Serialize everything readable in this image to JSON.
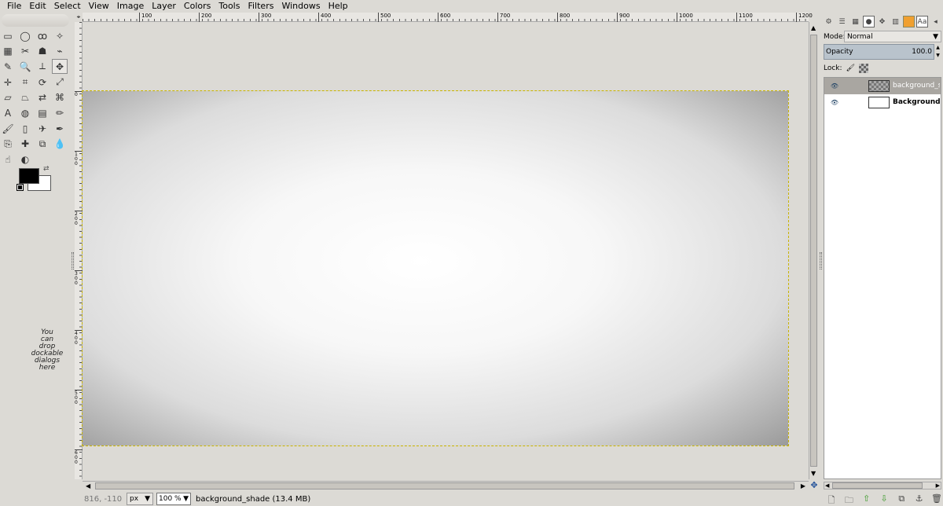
{
  "menu": [
    "File",
    "Edit",
    "Select",
    "View",
    "Image",
    "Layer",
    "Colors",
    "Tools",
    "Filters",
    "Windows",
    "Help"
  ],
  "toolbox": {
    "tools": [
      {
        "name": "rect-select-tool",
        "glyph": "▭"
      },
      {
        "name": "ellipse-select-tool",
        "glyph": "◯"
      },
      {
        "name": "free-select-tool",
        "glyph": "ꝏ"
      },
      {
        "name": "fuzzy-select-tool",
        "glyph": "✧"
      },
      {
        "name": "select-by-color-tool",
        "glyph": "▦"
      },
      {
        "name": "scissors-select-tool",
        "glyph": "✂"
      },
      {
        "name": "foreground-select-tool",
        "glyph": "☗"
      },
      {
        "name": "paths-tool",
        "glyph": "⌁"
      },
      {
        "name": "color-picker-tool",
        "glyph": "✎"
      },
      {
        "name": "zoom-tool",
        "glyph": "🔍"
      },
      {
        "name": "measure-tool",
        "glyph": "⟂"
      },
      {
        "name": "move-tool",
        "glyph": "✥"
      },
      {
        "name": "align-tool",
        "glyph": "✛"
      },
      {
        "name": "crop-tool",
        "glyph": "⌗"
      },
      {
        "name": "rotate-tool",
        "glyph": "⟳"
      },
      {
        "name": "scale-tool",
        "glyph": "⤢"
      },
      {
        "name": "shear-tool",
        "glyph": "▱"
      },
      {
        "name": "perspective-tool",
        "glyph": "⏢"
      },
      {
        "name": "flip-tool",
        "glyph": "⇄"
      },
      {
        "name": "cage-tool",
        "glyph": "⌘"
      },
      {
        "name": "text-tool",
        "glyph": "A"
      },
      {
        "name": "bucket-fill-tool",
        "glyph": "◍"
      },
      {
        "name": "blend-tool",
        "glyph": "▤"
      },
      {
        "name": "pencil-tool",
        "glyph": "✏"
      },
      {
        "name": "paintbrush-tool",
        "glyph": "🖌"
      },
      {
        "name": "eraser-tool",
        "glyph": "▯"
      },
      {
        "name": "airbrush-tool",
        "glyph": "✈"
      },
      {
        "name": "ink-tool",
        "glyph": "✒"
      },
      {
        "name": "clone-tool",
        "glyph": "⎘"
      },
      {
        "name": "heal-tool",
        "glyph": "✚"
      },
      {
        "name": "perspective-clone-tool",
        "glyph": "⧉"
      },
      {
        "name": "blur-tool",
        "glyph": "💧"
      },
      {
        "name": "smudge-tool",
        "glyph": "☝"
      },
      {
        "name": "dodge-burn-tool",
        "glyph": "◐"
      }
    ],
    "active_tool_index": 11,
    "fg_color": "#000000",
    "bg_color": "#ffffff",
    "drop_hint": [
      "You",
      "can",
      "drop",
      "dockable",
      "dialogs",
      "here"
    ]
  },
  "hruler": [
    "100",
    "200",
    "300",
    "400",
    "500",
    "600",
    "700",
    "800",
    "900",
    "1000",
    "1100",
    "1200"
  ],
  "vruler": [
    "0",
    "1\n0\n0",
    "2\n0\n0",
    "3\n0\n0",
    "4\n0\n0",
    "5\n0\n0",
    "6\n0\n0"
  ],
  "status": {
    "coords": "816, -110",
    "unit": "px",
    "zoom": "100 %",
    "message": "background_shade (13.4 MB)"
  },
  "dock": {
    "tabs": [
      "layers-tab",
      "channels-tab",
      "paths-tab",
      "brushes-tab",
      "patterns-tab",
      "gradients-tab",
      "colors-tab",
      "fonts-tab"
    ],
    "mode_label": "Mode:",
    "mode_value": "Normal",
    "opacity_label": "Opacity",
    "opacity_value": "100.0",
    "lock_label": "Lock:",
    "layers": [
      {
        "name": "background_s",
        "selected": true,
        "bold": false,
        "transparent": true
      },
      {
        "name": "Background",
        "selected": false,
        "bold": true,
        "transparent": false
      }
    ]
  }
}
